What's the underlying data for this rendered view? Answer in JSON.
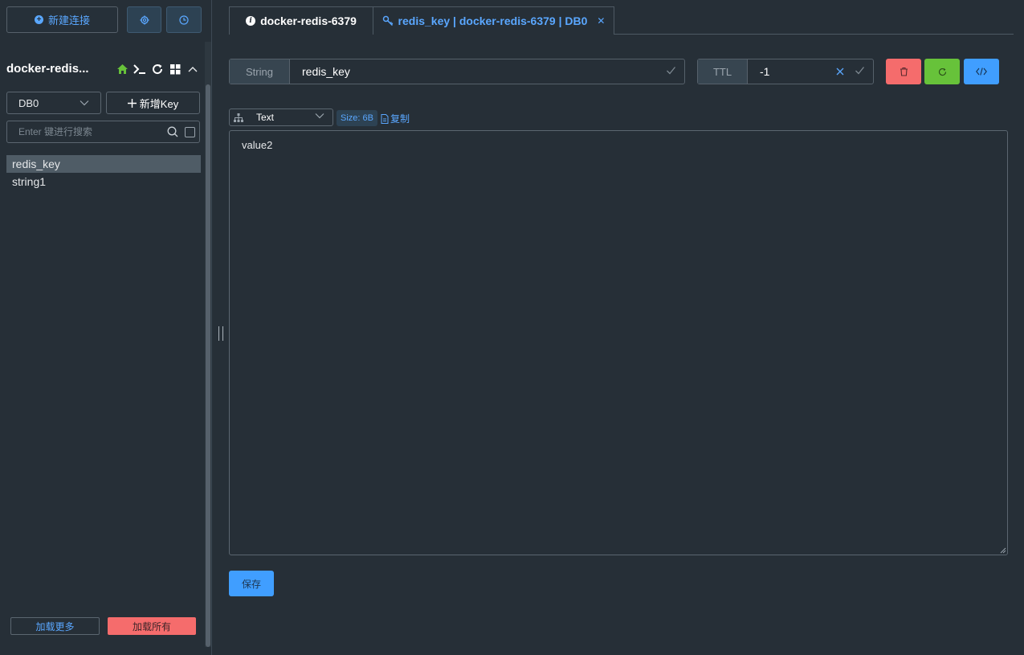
{
  "sidebar": {
    "new_connection_label": "新建连接",
    "connection_name": "docker-redis...",
    "db_select_value": "DB0",
    "add_key_label": "新增Key",
    "search_placeholder": "Enter 键进行搜索",
    "keys": [
      "redis_key",
      "string1"
    ],
    "active_key_index": 0,
    "load_more_label": "加载更多",
    "load_all_label": "加载所有"
  },
  "tabs": [
    {
      "label": "docker-redis-6379",
      "icon": "info-icon"
    },
    {
      "label": "redis_key | docker-redis-6379 | DB0",
      "icon": "key-icon",
      "closable": true
    }
  ],
  "key_editor": {
    "type_label": "String",
    "key_name": "redis_key",
    "ttl_label": "TTL",
    "ttl_value": "-1",
    "format_value": "Text",
    "size_label": "Size: 6B",
    "copy_label": "复制",
    "value": "value2",
    "save_label": "保存"
  },
  "colors": {
    "background": "#262f37",
    "accent": "#409eff",
    "danger": "#f56c6c",
    "success": "#67c23a"
  }
}
